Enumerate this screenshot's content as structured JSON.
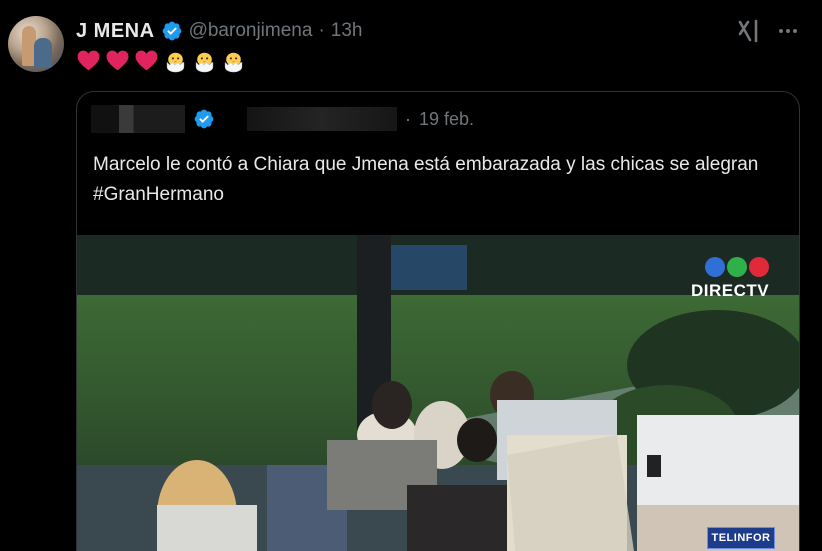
{
  "post": {
    "display_name": "J MENA",
    "handle": "@baronjimena",
    "separator": "·",
    "time": "13h",
    "emojis": [
      "red-heart",
      "red-heart",
      "red-heart",
      "hatching-chick",
      "hatching-chick",
      "hatching-chick"
    ]
  },
  "quote": {
    "separator": "·",
    "date": "19 feb.",
    "text": "Marcelo le contó a Chiara que Jmena está embarazada y las chicas se alegran #GranHermano",
    "media": {
      "broadcaster": "DIRECTV",
      "sponsor_badge": "TELINFOR"
    }
  },
  "colors": {
    "background": "#000000",
    "text": "#e7e9ea",
    "muted": "#71767b",
    "verified": "#1d9bf0",
    "border": "#2f3336"
  }
}
